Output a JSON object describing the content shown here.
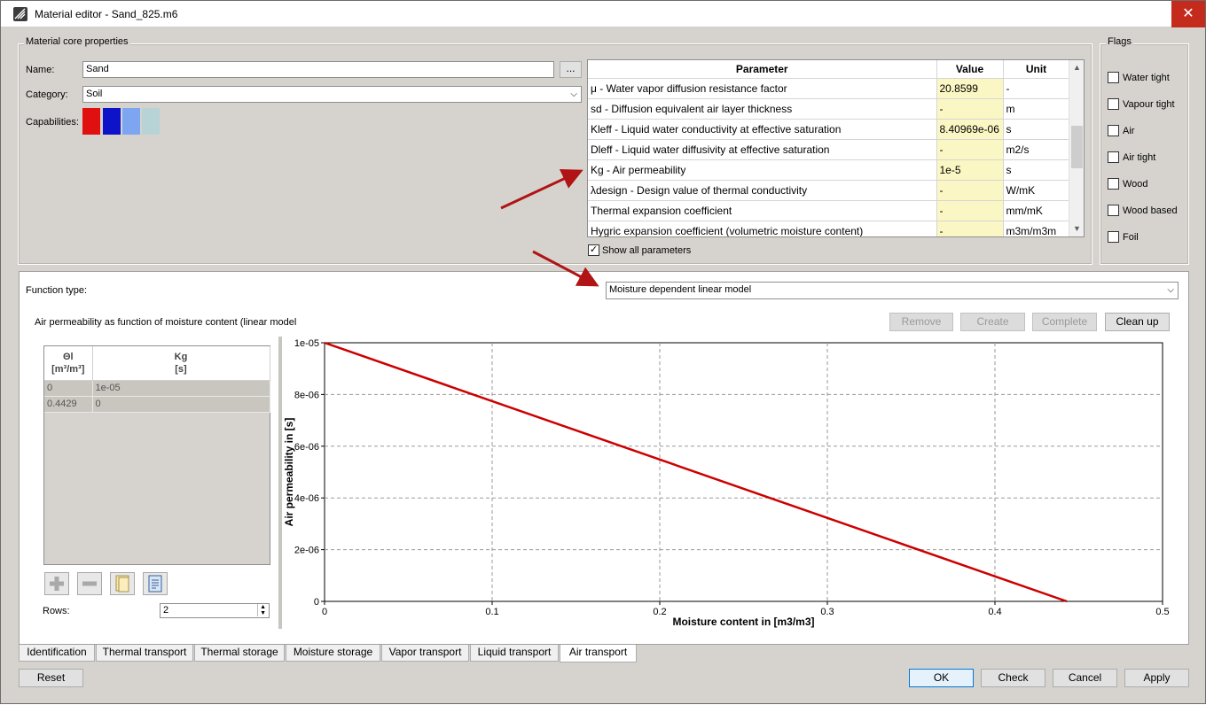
{
  "window": {
    "title": "Material editor - Sand_825.m6",
    "close_glyph": "✕"
  },
  "core": {
    "group_title": "Material core properties",
    "name_label": "Name:",
    "name_value": "Sand",
    "browse_label": "...",
    "category_label": "Category:",
    "category_value": "Soil",
    "capabilities_label": "Capabilities:",
    "capability_colors": [
      "#e01010",
      "#0e12c8",
      "#7ea6f0",
      "#b7d3d6"
    ]
  },
  "params": {
    "headers": {
      "parameter": "Parameter",
      "value": "Value",
      "unit": "Unit"
    },
    "rows": [
      {
        "parameter": "μ - Water vapor diffusion resistance factor",
        "value": "20.8599",
        "unit": "-"
      },
      {
        "parameter": "sd - Diffusion equivalent air layer thickness",
        "value": "-",
        "unit": "m"
      },
      {
        "parameter": "Kleff - Liquid water conductivity at effective saturation",
        "value": "8.40969e-06",
        "unit": "s"
      },
      {
        "parameter": "Dleff - Liquid water diffusivity at effective saturation",
        "value": "-",
        "unit": "m2/s"
      },
      {
        "parameter": "Kg - Air permeability",
        "value": "1e-5",
        "unit": "s"
      },
      {
        "parameter": "λdesign - Design value of thermal conductivity",
        "value": "-",
        "unit": "W/mK"
      },
      {
        "parameter": "Thermal expansion coefficient",
        "value": "-",
        "unit": "mm/mK"
      },
      {
        "parameter": "Hygric expansion coefficient (volumetric moisture content)",
        "value": "-",
        "unit": "m3m/m3m"
      }
    ],
    "show_all_label": "Show all parameters",
    "show_all_checked": true,
    "scroll_up": "▲",
    "scroll_down": "▼"
  },
  "flags": {
    "group_title": "Flags",
    "items": [
      {
        "label": "Water tight",
        "checked": false
      },
      {
        "label": "Vapour tight",
        "checked": false
      },
      {
        "label": "Air",
        "checked": false
      },
      {
        "label": "Air tight",
        "checked": false
      },
      {
        "label": "Wood",
        "checked": false
      },
      {
        "label": "Wood based",
        "checked": false
      },
      {
        "label": "Foil",
        "checked": false
      }
    ]
  },
  "function": {
    "type_label": "Function type:",
    "type_value": "Moisture dependent linear model",
    "caption": "Air permeability as function of moisture content (linear model",
    "buttons": {
      "remove": "Remove",
      "create": "Create",
      "complete": "Complete",
      "cleanup": "Clean up"
    },
    "table": {
      "col1_header": "Θl",
      "col1_unit": "[m³/m³]",
      "col2_header": "Kg",
      "col2_unit": "[s]",
      "rows": [
        [
          "0",
          "1e-05"
        ],
        [
          "0.4429",
          "0"
        ]
      ]
    },
    "rows_label": "Rows:",
    "rows_value": "2"
  },
  "chart_data": {
    "type": "line",
    "xlabel": "Moisture content in [m3/m3]",
    "ylabel": "Air permeability in [s]",
    "xlim": [
      0,
      0.5
    ],
    "ylim": [
      0,
      1e-05
    ],
    "x_ticks": [
      "0",
      "0.1",
      "0.2",
      "0.3",
      "0.4",
      "0.5"
    ],
    "y_ticks": [
      "0",
      "2e-06",
      "4e-06",
      "6e-06",
      "8e-06",
      "1e-05"
    ],
    "grid": true,
    "color": "#cc0000",
    "series": [
      {
        "x": [
          0,
          0.4429
        ],
        "y": [
          1e-05,
          0
        ]
      }
    ]
  },
  "tabs": [
    "Identification",
    "Thermal transport",
    "Thermal storage",
    "Moisture storage",
    "Vapor transport",
    "Liquid transport",
    "Air transport"
  ],
  "active_tab": "Air transport",
  "footer": {
    "reset": "Reset",
    "ok": "OK",
    "check": "Check",
    "cancel": "Cancel",
    "apply": "Apply"
  },
  "annotation_color": "#b01414"
}
